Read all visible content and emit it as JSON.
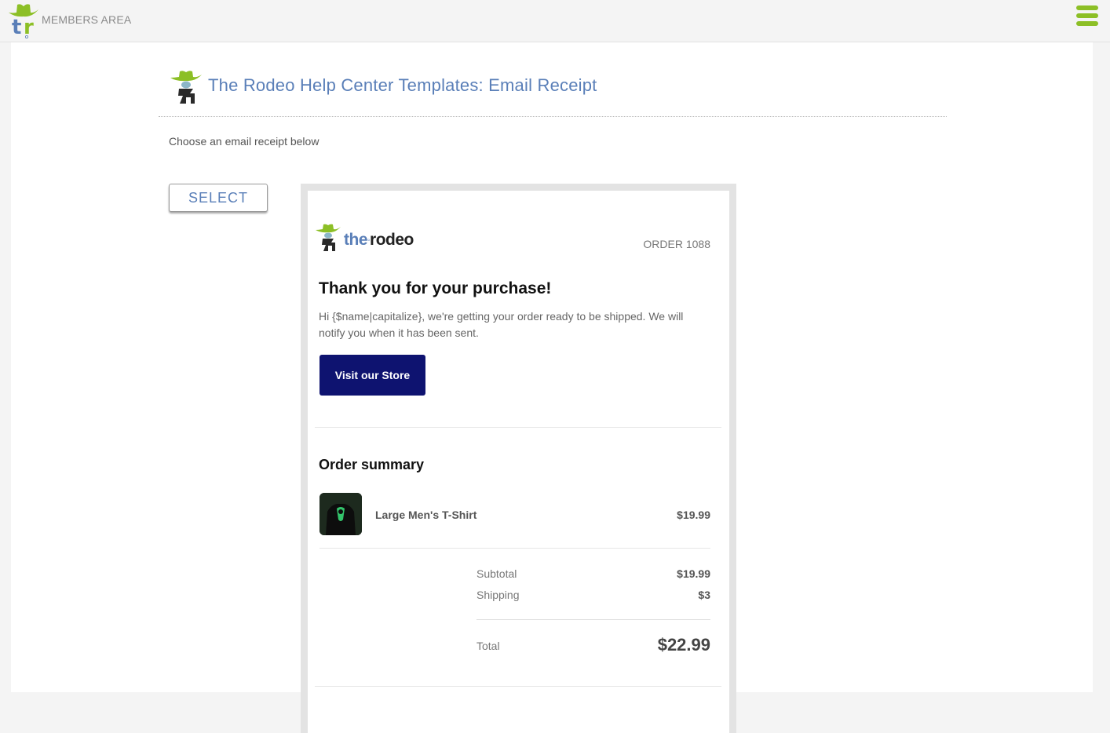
{
  "header": {
    "brand_label": "MEMBERS AREA",
    "menu_icon": "hamburger-menu-icon",
    "accent_color": "#8cbf26"
  },
  "page": {
    "title": "The Rodeo Help Center Templates: Email Receipt",
    "instruction": "Choose an email receipt below",
    "select_label": "SELECT",
    "title_color": "#5a7fb8"
  },
  "email": {
    "brand_the": "the",
    "brand_rodeo": "rodeo",
    "order_label": "ORDER 1088",
    "heading": "Thank you for your purchase!",
    "greeting": "Hi {$name|capitalize}, we're getting your order ready to be shipped. We will notify you when it has been sent.",
    "cta_label": "Visit our Store",
    "cta_color": "#0e1370",
    "summary_title": "Order summary",
    "items": [
      {
        "name": "Large Men's T-Shirt",
        "price": "$19.99"
      }
    ],
    "subtotal_label": "Subtotal",
    "subtotal_value": "$19.99",
    "shipping_label": "Shipping",
    "shipping_value": "$3",
    "total_label": "Total",
    "total_value": "$22.99"
  }
}
